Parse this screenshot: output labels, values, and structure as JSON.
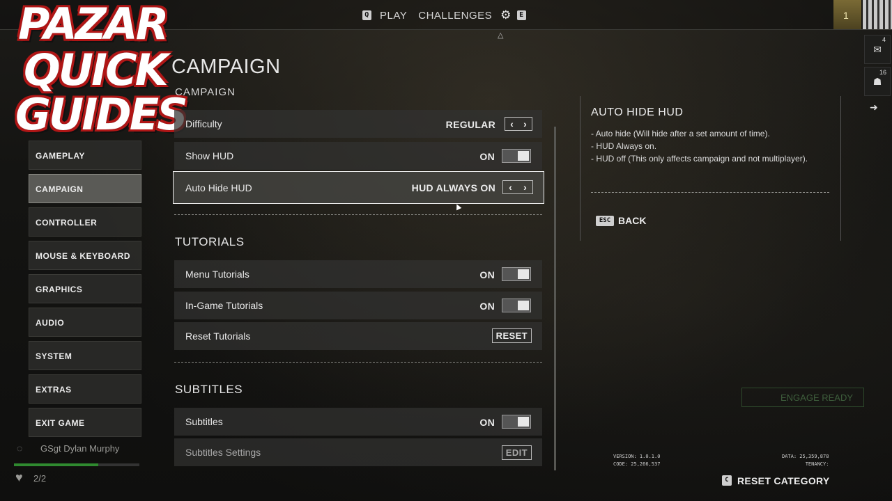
{
  "nav": {
    "left_key": "Q",
    "play": "PLAY",
    "challenges": "CHALLENGES",
    "gear_icon": "gear-icon",
    "right_key": "E"
  },
  "rank": {
    "level": "1"
  },
  "side_buttons": {
    "mail_count": "4",
    "squad_count": "16"
  },
  "logo": {
    "line1": "PAZAR",
    "line2": "QUICK",
    "line3": "GUIDES"
  },
  "page": {
    "title": "CAMPAIGN",
    "section": "CAMPAIGN"
  },
  "categories": [
    {
      "label": "GAMEPLAY"
    },
    {
      "label": "CAMPAIGN",
      "active": true
    },
    {
      "label": "CONTROLLER"
    },
    {
      "label": "MOUSE & KEYBOARD"
    },
    {
      "label": "GRAPHICS"
    },
    {
      "label": "AUDIO"
    },
    {
      "label": "SYSTEM"
    },
    {
      "label": "EXTRAS"
    },
    {
      "label": "EXIT GAME"
    }
  ],
  "campaign": {
    "difficulty": {
      "label": "Difficulty",
      "value": "REGULAR"
    },
    "show_hud": {
      "label": "Show HUD",
      "value": "ON"
    },
    "auto_hide_hud": {
      "label": "Auto Hide HUD",
      "value": "HUD ALWAYS ON"
    }
  },
  "tutorials": {
    "heading": "TUTORIALS",
    "menu": {
      "label": "Menu Tutorials",
      "value": "ON"
    },
    "ingame": {
      "label": "In-Game Tutorials",
      "value": "ON"
    },
    "reset": {
      "label": "Reset Tutorials",
      "button": "RESET"
    }
  },
  "subtitles": {
    "heading": "SUBTITLES",
    "subtitles": {
      "label": "Subtitles",
      "value": "ON"
    },
    "settings": {
      "label": "Subtitles Settings",
      "button": "EDIT"
    }
  },
  "info": {
    "title": "AUTO HIDE HUD",
    "lines": [
      "- Auto hide (Will hide after a set amount of time).",
      "- HUD Always on.",
      "- HUD off (This only affects campaign and not multiplayer)."
    ],
    "back_key": "ESC",
    "back_label": "BACK"
  },
  "player": {
    "name": "GSgt Dylan Murphy",
    "lives": "2/2",
    "xp_fraction": 0.67
  },
  "footer": {
    "version": "VERSION: 1.0.1.0",
    "code": "CODE: 25,266,537",
    "data": "DATA: 25,359,878",
    "tenancy": "TENANCY:",
    "reset_key": "C",
    "reset_label": "RESET CATEGORY",
    "engage_label": "ENGAGE READY"
  }
}
